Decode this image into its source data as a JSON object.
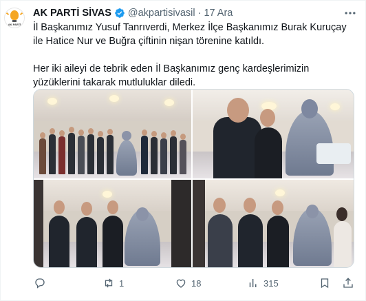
{
  "tweet": {
    "author_name": "AK PARTİ SİVAS",
    "handle": "@akpartisivasil",
    "separator": "·",
    "time": "17 Ara",
    "avatar_text": "AK PARTİ",
    "paragraph1": "İl Başkanımız Yusuf Tanrıverdi, Merkez İlçe Başkanımız Burak Kuruçay ile Hatice Nur ve Buğra çiftinin nişan törenine katıldı.",
    "paragraph2": "Her iki aileyi de tebrik eden İl Başkanımız genç kardeşlerimizin yüzüklerini takarak mutluluklar diledi."
  },
  "actions": {
    "reply_icon": "reply-icon",
    "retweets": "1",
    "likes": "18",
    "views": "315",
    "bookmark_icon": "bookmark-icon",
    "share_icon": "share-icon"
  },
  "colors": {
    "text": "#0f1419",
    "secondary": "#536471",
    "verified": "#1d9bf0",
    "border": "#cfd9de"
  }
}
